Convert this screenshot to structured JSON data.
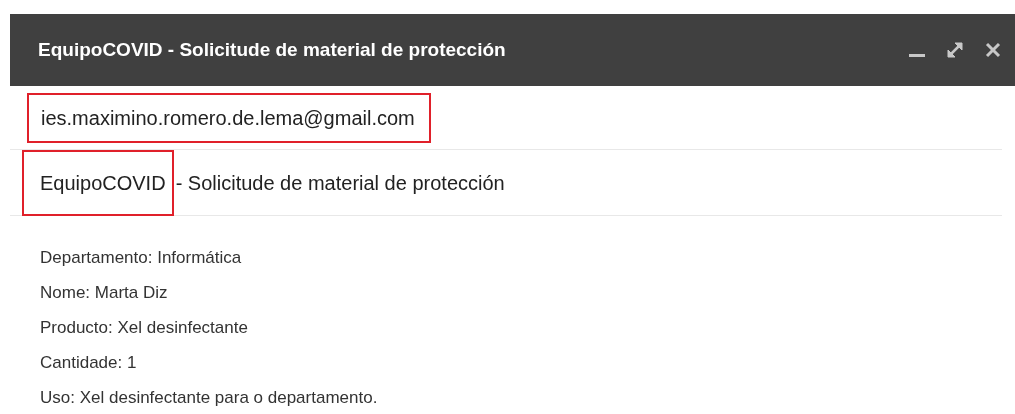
{
  "window": {
    "title": "EquipoCOVID - Solicitude de material de protección"
  },
  "title_controls": [
    {
      "kind": "minimize"
    },
    {
      "kind": "expand"
    },
    {
      "kind": "close"
    }
  ],
  "recipient": {
    "text": "ies.maximino.romero.de.lema@gmail.com",
    "highlighted": true
  },
  "subject": [
    {
      "text": "EquipoCOVID",
      "highlighted": true
    },
    {
      "text": "- Solicitude de material de protección",
      "highlighted": false
    }
  ],
  "body": [
    "Departamento: Informática",
    "Nome: Marta Diz",
    "Producto: Xel desinfectante",
    "Cantidade: 1",
    "Uso: Xel desinfectante para o departamento."
  ]
}
